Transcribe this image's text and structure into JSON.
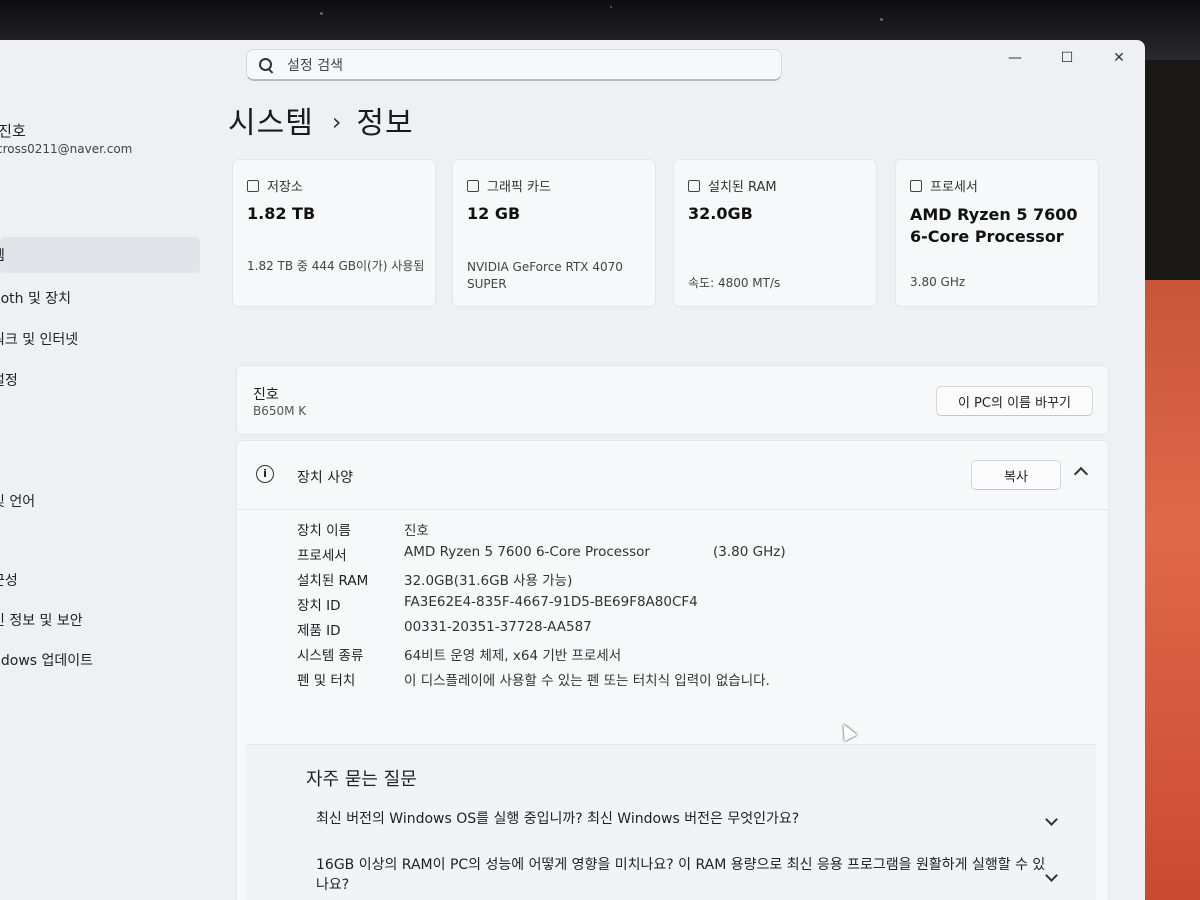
{
  "search": {
    "placeholder": "설정 검색"
  },
  "user": {
    "name": "l진호",
    "email": "cross0211@naver.com"
  },
  "sidebar": {
    "items": [
      {
        "label": "템",
        "selected": true
      },
      {
        "label": "ooth 및 장치"
      },
      {
        "label": "워크 및 인터넷"
      },
      {
        "label": "설정"
      },
      {
        "label": "및 언어"
      },
      {
        "label": "l"
      },
      {
        "label": "근성"
      },
      {
        "label": "인 정보 및 보안"
      },
      {
        "label": "ndows 업데이트"
      }
    ]
  },
  "breadcrumb": {
    "section": "시스템",
    "separator": "›",
    "page": "정보"
  },
  "cards": [
    {
      "icon": "storage-icon",
      "title": "저장소",
      "value": "1.82 TB",
      "sub": "1.82 TB 중 444 GB이(가) 사용됨"
    },
    {
      "icon": "gpu-icon",
      "title": "그래픽 카드",
      "value": "12 GB",
      "sub": "NVIDIA GeForce RTX 4070 SUPER"
    },
    {
      "icon": "ram-icon",
      "title": "설치된 RAM",
      "value": "32.0GB",
      "sub": "속도: 4800 MT/s"
    },
    {
      "icon": "processor-icon",
      "title": "프로세서",
      "value": "AMD Ryzen 5 7600 6-Core Processor",
      "sub": "3.80 GHz"
    }
  ],
  "pc": {
    "name": "진호",
    "model": "B650M K",
    "rename_label": "이 PC의 이름 바꾸기"
  },
  "specs": {
    "title": "장치 사양",
    "copy_label": "복사",
    "rows": [
      {
        "key": "장치 이름",
        "value": "진호",
        "extra": ""
      },
      {
        "key": "프로세서",
        "value": "AMD Ryzen 5 7600 6-Core Processor",
        "extra": "(3.80 GHz)"
      },
      {
        "key": "설치된 RAM",
        "value": "32.0GB(31.6GB 사용 가능)",
        "extra": ""
      },
      {
        "key": "장치 ID",
        "value": "FA3E62E4-835F-4667-91D5-BE69F8A80CF4",
        "extra": ""
      },
      {
        "key": "제품 ID",
        "value": "00331-20351-37728-AA587",
        "extra": ""
      },
      {
        "key": "시스템 종류",
        "value": "64비트 운영 체제, x64 기반 프로세서",
        "extra": ""
      },
      {
        "key": "펜 및 터치",
        "value": "이 디스플레이에 사용할 수 있는 펜 또는 터치식 입력이 없습니다.",
        "extra": ""
      }
    ]
  },
  "faq": {
    "title": "자주 묻는 질문",
    "questions": [
      "최신 버전의 Windows OS를 실행 중입니까? 최신 Windows 버전은 무엇인가요?",
      "16GB 이상의 RAM이 PC의 성능에 어떻게 영향을 미치나요? 이 RAM 용량으로 최신 응용 프로그램을 원활하게 실행할 수 있나요?"
    ]
  },
  "window_controls": {
    "minimize": "—",
    "maximize": "☐",
    "close": "✕"
  }
}
